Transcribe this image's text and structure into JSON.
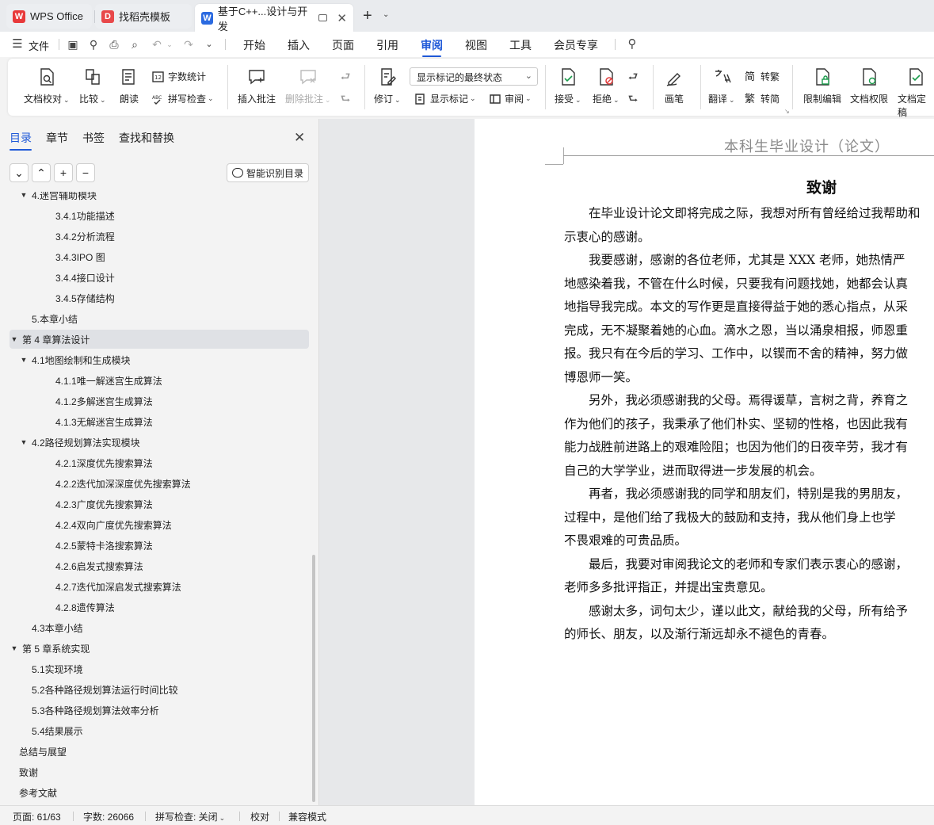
{
  "tabs": [
    {
      "label": "WPS Office",
      "state": "inactive"
    },
    {
      "label": "找稻壳模板",
      "state": "inactive"
    },
    {
      "label": "基于C++...设计与开发",
      "state": "active"
    }
  ],
  "menu": {
    "file": "文件",
    "items": [
      "开始",
      "插入",
      "页面",
      "引用",
      "审阅",
      "视图",
      "工具",
      "会员专享"
    ],
    "active": "审阅"
  },
  "ribbon": {
    "doc_check": "文档校对",
    "compare": "比较",
    "read_aloud": "朗读",
    "word_count": "字数统计",
    "spell_check": "拼写检查",
    "insert_comment": "插入批注",
    "delete_comment": "删除批注",
    "track_changes": "修订",
    "markup_state": "显示标记的最终状态",
    "show_markup": "显示标记",
    "review": "审阅",
    "accept": "接受",
    "reject": "拒绝",
    "ink": "画笔",
    "translate": "翻译",
    "to_traditional": "转繁",
    "to_simplified": "转简",
    "restrict_edit": "限制编辑",
    "doc_permission": "文档权限",
    "doc_final": "文档定稿"
  },
  "nav": {
    "tabs": [
      "目录",
      "章节",
      "书签",
      "查找和替换"
    ],
    "active_tab": "目录",
    "smart_toc": "智能识别目录",
    "toc": [
      {
        "text": "4.迷宫辅助模块",
        "level": 2,
        "expand": "▼"
      },
      {
        "text": "3.4.1功能描述",
        "level": 3
      },
      {
        "text": "3.4.2分析流程",
        "level": 3
      },
      {
        "text": "3.4.3IPO 图",
        "level": 3
      },
      {
        "text": "3.4.4接口设计",
        "level": 3
      },
      {
        "text": "3.4.5存储结构",
        "level": 3
      },
      {
        "text": "5.本章小结",
        "level": 2
      },
      {
        "text": "第 4 章算法设计",
        "level": 1,
        "expand": "▼",
        "selected": true
      },
      {
        "text": "4.1地图绘制和生成模块",
        "level": 2,
        "expand": "▼"
      },
      {
        "text": "4.1.1唯一解迷宫生成算法",
        "level": 3
      },
      {
        "text": "4.1.2多解迷宫生成算法",
        "level": 3
      },
      {
        "text": "4.1.3无解迷宫生成算法",
        "level": 3
      },
      {
        "text": "4.2路径规划算法实现模块",
        "level": 2,
        "expand": "▼"
      },
      {
        "text": "4.2.1深度优先搜索算法",
        "level": 3
      },
      {
        "text": "4.2.2迭代加深深度优先搜索算法",
        "level": 3
      },
      {
        "text": "4.2.3广度优先搜索算法",
        "level": 3
      },
      {
        "text": "4.2.4双向广度优先搜索算法",
        "level": 3
      },
      {
        "text": "4.2.5蒙特卡洛搜索算法",
        "level": 3
      },
      {
        "text": "4.2.6启发式搜索算法",
        "level": 3
      },
      {
        "text": "4.2.7迭代加深启发式搜索算法",
        "level": 3
      },
      {
        "text": "4.2.8遗传算法",
        "level": 3
      },
      {
        "text": "4.3本章小结",
        "level": 2
      },
      {
        "text": "第 5 章系统实现",
        "level": 1,
        "expand": "▼"
      },
      {
        "text": "5.1实现环境",
        "level": 2
      },
      {
        "text": "5.2各种路径规划算法运行时间比较",
        "level": 2
      },
      {
        "text": "5.3各种路径规划算法效率分析",
        "level": 2
      },
      {
        "text": "5.4结果展示",
        "level": 2
      },
      {
        "text": "总结与展望",
        "level": 1
      },
      {
        "text": "致谢",
        "level": 1
      },
      {
        "text": "参考文献",
        "level": 1
      }
    ]
  },
  "document": {
    "header": "本科生毕业设计（论文）",
    "title": "致谢",
    "lines": [
      "　　在毕业设计论文即将完成之际，我想对所有曾经给过我帮助和",
      "示衷心的感谢。",
      "　　我要感谢，感谢的各位老师，尤其是 XXX 老师，她热情严",
      "地感染着我，不管在什么时候，只要我有问题找她，她都会认真",
      "地指导我完成。本文的写作更是直接得益于她的悉心指点，从采",
      "完成，无不凝聚着她的心血。滴水之恩，当以涌泉相报，师恩重",
      "报。我只有在今后的学习、工作中，以锲而不舍的精神，努力做",
      "博恩师一笑。",
      "　　另外，我必须感谢我的父母。焉得谖草，言树之背，养育之",
      "作为他们的孩子，我秉承了他们朴实、坚韧的性格，也因此我有",
      "能力战胜前进路上的艰难险阻；也因为他们的日夜辛劳，我才有",
      "自己的大学学业，进而取得进一步发展的机会。",
      "　　再者，我必须感谢我的同学和朋友们，特别是我的男朋友，",
      "过程中，是他们给了我极大的鼓励和支持，我从他们身上也学",
      "不畏艰难的可贵品质。",
      "　　最后，我要对审阅我论文的老师和专家们表示衷心的感谢，",
      "老师多多批评指正，并提出宝贵意见。",
      "　　感谢太多，词句太少，谨以此文，献给我的父母，所有给予",
      "的师长、朋友，以及渐行渐远却永不褪色的青春。"
    ]
  },
  "status": {
    "page": "页面: 61/63",
    "words": "字数: 26066",
    "spell": "拼写检查: 关闭",
    "proof": "校对",
    "compat": "兼容模式"
  },
  "colors": {
    "accent": "#1f59d8",
    "wps_red": "#e8393a",
    "docer_red": "#e8484a",
    "writer_blue": "#2b6ae0"
  }
}
